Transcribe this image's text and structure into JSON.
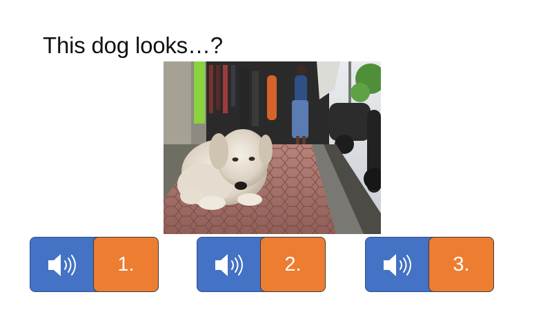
{
  "slide": {
    "title": "This dog looks…?"
  },
  "photo": {
    "icon": "photo-of-white-dog-on-sidewalk"
  },
  "answers": [
    {
      "label": "1.",
      "sound_icon": "speaker-icon"
    },
    {
      "label": "2.",
      "sound_icon": "speaker-icon"
    },
    {
      "label": "3.",
      "sound_icon": "speaker-icon"
    }
  ],
  "colors": {
    "sound_button": "#4472c4",
    "number_button": "#ed7d31",
    "title_text": "#111111"
  }
}
